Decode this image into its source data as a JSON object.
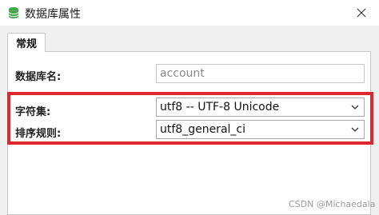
{
  "window": {
    "title": "数据库属性"
  },
  "tabs": [
    {
      "label": "常规"
    }
  ],
  "form": {
    "db_name_label": "数据库名:",
    "db_name_value": "account",
    "charset_label": "字符集:",
    "charset_value": "utf8 -- UTF-8 Unicode",
    "collation_label": "排序规则:",
    "collation_value": "utf8_general_ci"
  },
  "watermark": "CSDN @Michaedala",
  "colors": {
    "highlight": "#e0262f",
    "icon": "#3fa64a"
  }
}
